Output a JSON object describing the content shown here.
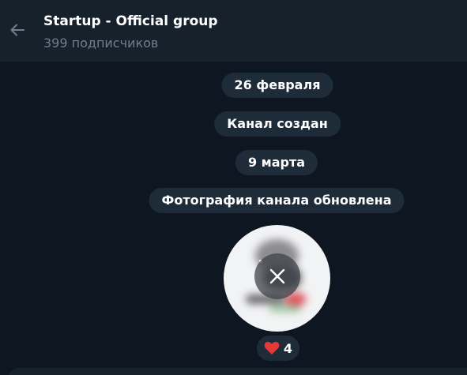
{
  "header": {
    "title": "Startup - Official group",
    "subtitle": "399 подписчиков",
    "back_icon": "arrow-left-icon"
  },
  "messages": {
    "date1": "26 февраля",
    "service1": "Канал создан",
    "date2": "9 марта",
    "service2": "Фотография канала обновлена"
  },
  "photo": {
    "cancel_icon": "close-icon"
  },
  "reaction": {
    "emoji": "heart-icon",
    "count": "4"
  },
  "colors": {
    "background": "#0e1621",
    "header": "#17212b",
    "pill": "#1e2c3a",
    "subtitle": "#6d7f8f",
    "heart": "#e53935"
  }
}
